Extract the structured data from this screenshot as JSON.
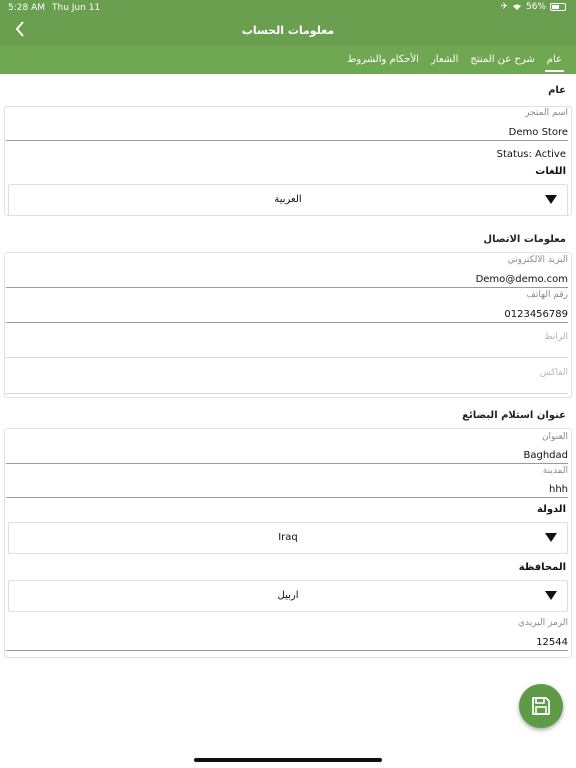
{
  "status_bar": {
    "time": "5:28 AM",
    "date": "Thu Jun 11",
    "battery": "56%",
    "battery_level": 0.56
  },
  "nav": {
    "title": "معلومات الحساب"
  },
  "tabs": [
    {
      "label": "عام"
    },
    {
      "label": "شرح عن المنتج"
    },
    {
      "label": "الشعار"
    },
    {
      "label": "الأحكام والشروط"
    }
  ],
  "general": {
    "section_title": "عام",
    "store_name": {
      "label": "اسم المتجر",
      "value": "Demo Store"
    },
    "status": "Status: Active",
    "languages_label": "اللغات",
    "language_value": "العربية"
  },
  "contact": {
    "section_title": "معلومات الاتصال",
    "email": {
      "label": "البريد الالكتروني",
      "value": "Demo@demo.com"
    },
    "phone": {
      "label": "رقم الهاتف",
      "value": "0123456789"
    },
    "link": {
      "placeholder": "الرابط"
    },
    "fax": {
      "placeholder": "الفاكس"
    }
  },
  "pickup": {
    "section_title": "عنوان استلام البضائع",
    "address": {
      "label": "العنوان",
      "value": "Baghdad"
    },
    "city": {
      "label": "المدينة",
      "value": "hhh"
    },
    "country_label": "الدولة",
    "country_value": "Iraq",
    "province_label": "المحافظة",
    "province_value": "اربيل",
    "postal": {
      "label": "الرمز البريدي",
      "value": "12544"
    }
  },
  "icons": {
    "back": "chevron-left-icon",
    "save": "floppy-disk-icon",
    "dropdown": "triangle-down-icon"
  },
  "colors": {
    "header": "#6a9f4f",
    "tabs": "#70a852",
    "fab": "#5f9a48"
  }
}
